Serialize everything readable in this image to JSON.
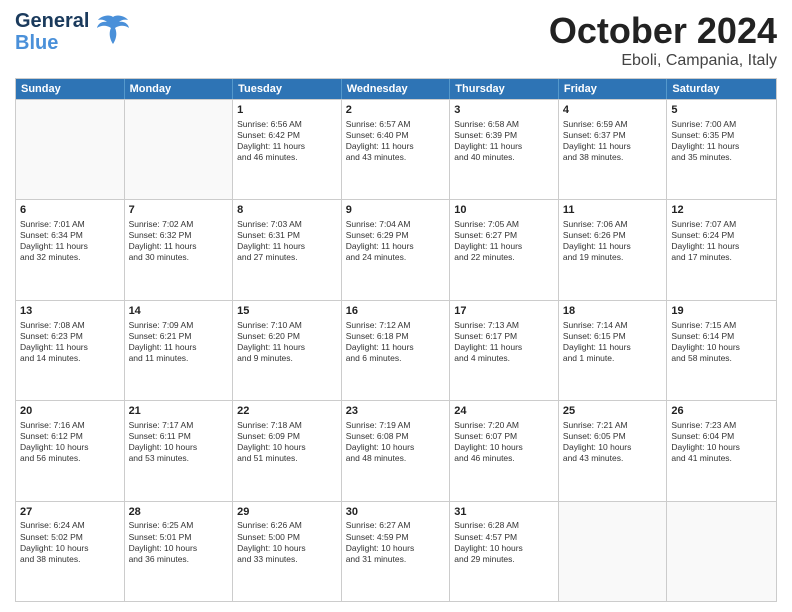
{
  "header": {
    "logo_line1": "General",
    "logo_line2": "Blue",
    "title": "October 2024",
    "location": "Eboli, Campania, Italy"
  },
  "weekdays": [
    "Sunday",
    "Monday",
    "Tuesday",
    "Wednesday",
    "Thursday",
    "Friday",
    "Saturday"
  ],
  "rows": [
    [
      {
        "day": "",
        "detail": ""
      },
      {
        "day": "",
        "detail": ""
      },
      {
        "day": "1",
        "detail": "Sunrise: 6:56 AM\nSunset: 6:42 PM\nDaylight: 11 hours\nand 46 minutes."
      },
      {
        "day": "2",
        "detail": "Sunrise: 6:57 AM\nSunset: 6:40 PM\nDaylight: 11 hours\nand 43 minutes."
      },
      {
        "day": "3",
        "detail": "Sunrise: 6:58 AM\nSunset: 6:39 PM\nDaylight: 11 hours\nand 40 minutes."
      },
      {
        "day": "4",
        "detail": "Sunrise: 6:59 AM\nSunset: 6:37 PM\nDaylight: 11 hours\nand 38 minutes."
      },
      {
        "day": "5",
        "detail": "Sunrise: 7:00 AM\nSunset: 6:35 PM\nDaylight: 11 hours\nand 35 minutes."
      }
    ],
    [
      {
        "day": "6",
        "detail": "Sunrise: 7:01 AM\nSunset: 6:34 PM\nDaylight: 11 hours\nand 32 minutes."
      },
      {
        "day": "7",
        "detail": "Sunrise: 7:02 AM\nSunset: 6:32 PM\nDaylight: 11 hours\nand 30 minutes."
      },
      {
        "day": "8",
        "detail": "Sunrise: 7:03 AM\nSunset: 6:31 PM\nDaylight: 11 hours\nand 27 minutes."
      },
      {
        "day": "9",
        "detail": "Sunrise: 7:04 AM\nSunset: 6:29 PM\nDaylight: 11 hours\nand 24 minutes."
      },
      {
        "day": "10",
        "detail": "Sunrise: 7:05 AM\nSunset: 6:27 PM\nDaylight: 11 hours\nand 22 minutes."
      },
      {
        "day": "11",
        "detail": "Sunrise: 7:06 AM\nSunset: 6:26 PM\nDaylight: 11 hours\nand 19 minutes."
      },
      {
        "day": "12",
        "detail": "Sunrise: 7:07 AM\nSunset: 6:24 PM\nDaylight: 11 hours\nand 17 minutes."
      }
    ],
    [
      {
        "day": "13",
        "detail": "Sunrise: 7:08 AM\nSunset: 6:23 PM\nDaylight: 11 hours\nand 14 minutes."
      },
      {
        "day": "14",
        "detail": "Sunrise: 7:09 AM\nSunset: 6:21 PM\nDaylight: 11 hours\nand 11 minutes."
      },
      {
        "day": "15",
        "detail": "Sunrise: 7:10 AM\nSunset: 6:20 PM\nDaylight: 11 hours\nand 9 minutes."
      },
      {
        "day": "16",
        "detail": "Sunrise: 7:12 AM\nSunset: 6:18 PM\nDaylight: 11 hours\nand 6 minutes."
      },
      {
        "day": "17",
        "detail": "Sunrise: 7:13 AM\nSunset: 6:17 PM\nDaylight: 11 hours\nand 4 minutes."
      },
      {
        "day": "18",
        "detail": "Sunrise: 7:14 AM\nSunset: 6:15 PM\nDaylight: 11 hours\nand 1 minute."
      },
      {
        "day": "19",
        "detail": "Sunrise: 7:15 AM\nSunset: 6:14 PM\nDaylight: 10 hours\nand 58 minutes."
      }
    ],
    [
      {
        "day": "20",
        "detail": "Sunrise: 7:16 AM\nSunset: 6:12 PM\nDaylight: 10 hours\nand 56 minutes."
      },
      {
        "day": "21",
        "detail": "Sunrise: 7:17 AM\nSunset: 6:11 PM\nDaylight: 10 hours\nand 53 minutes."
      },
      {
        "day": "22",
        "detail": "Sunrise: 7:18 AM\nSunset: 6:09 PM\nDaylight: 10 hours\nand 51 minutes."
      },
      {
        "day": "23",
        "detail": "Sunrise: 7:19 AM\nSunset: 6:08 PM\nDaylight: 10 hours\nand 48 minutes."
      },
      {
        "day": "24",
        "detail": "Sunrise: 7:20 AM\nSunset: 6:07 PM\nDaylight: 10 hours\nand 46 minutes."
      },
      {
        "day": "25",
        "detail": "Sunrise: 7:21 AM\nSunset: 6:05 PM\nDaylight: 10 hours\nand 43 minutes."
      },
      {
        "day": "26",
        "detail": "Sunrise: 7:23 AM\nSunset: 6:04 PM\nDaylight: 10 hours\nand 41 minutes."
      }
    ],
    [
      {
        "day": "27",
        "detail": "Sunrise: 6:24 AM\nSunset: 5:02 PM\nDaylight: 10 hours\nand 38 minutes."
      },
      {
        "day": "28",
        "detail": "Sunrise: 6:25 AM\nSunset: 5:01 PM\nDaylight: 10 hours\nand 36 minutes."
      },
      {
        "day": "29",
        "detail": "Sunrise: 6:26 AM\nSunset: 5:00 PM\nDaylight: 10 hours\nand 33 minutes."
      },
      {
        "day": "30",
        "detail": "Sunrise: 6:27 AM\nSunset: 4:59 PM\nDaylight: 10 hours\nand 31 minutes."
      },
      {
        "day": "31",
        "detail": "Sunrise: 6:28 AM\nSunset: 4:57 PM\nDaylight: 10 hours\nand 29 minutes."
      },
      {
        "day": "",
        "detail": ""
      },
      {
        "day": "",
        "detail": ""
      }
    ]
  ]
}
